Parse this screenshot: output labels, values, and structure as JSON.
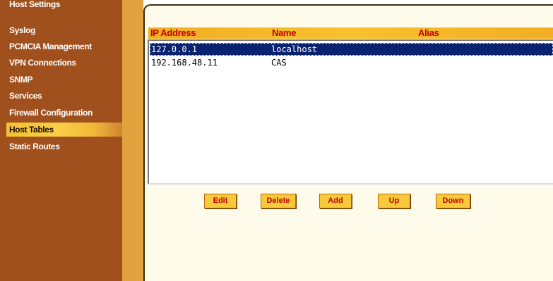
{
  "sidebar": {
    "items": [
      {
        "label": "Host Settings",
        "active": false
      },
      {
        "label": "Syslog",
        "active": false
      },
      {
        "label": "PCMCIA Management",
        "active": false
      },
      {
        "label": "VPN Connections",
        "active": false
      },
      {
        "label": "SNMP",
        "active": false
      },
      {
        "label": "Services",
        "active": false
      },
      {
        "label": "Firewall Configuration",
        "active": false
      },
      {
        "label": "Host Tables",
        "active": true
      },
      {
        "label": "Static Routes",
        "active": false
      }
    ]
  },
  "host_table": {
    "columns": [
      "IP Address",
      "Name",
      "Alias"
    ],
    "rows": [
      {
        "ip": "127.0.0.1",
        "name": "localhost",
        "alias": "",
        "selected": true
      },
      {
        "ip": "192.168.48.11",
        "name": "CAS",
        "alias": "",
        "selected": false
      }
    ]
  },
  "buttons": {
    "edit": "Edit",
    "delete": "Delete",
    "add": "Add",
    "up": "Up",
    "down": "Down"
  },
  "colors": {
    "sidebar": "#a0501c",
    "divider_stripe": "#e2a23d",
    "content_background": "#fffbea",
    "header_bar": "#f7c12c",
    "header_text": "#c00000",
    "selection": "#0a2370",
    "button_fill": "#f8c93a"
  }
}
